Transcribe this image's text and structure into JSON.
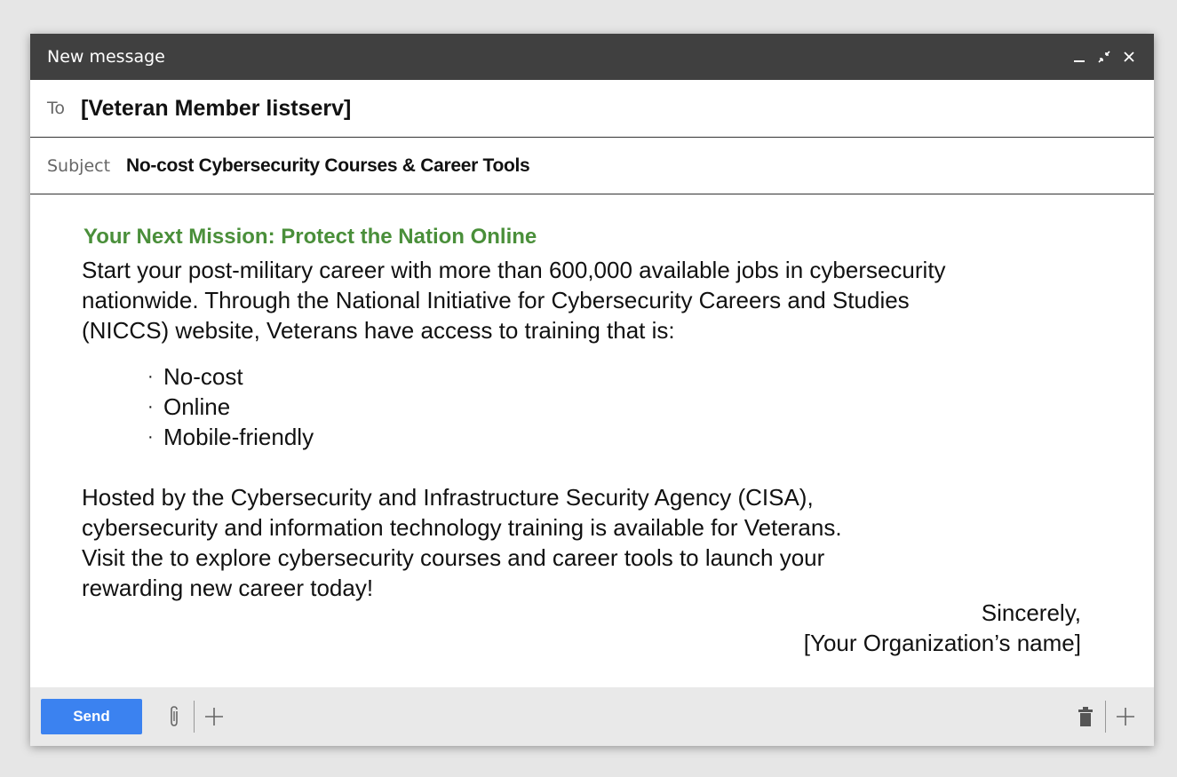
{
  "window": {
    "title": "New message",
    "controls": {
      "minimize": "minimize-icon",
      "expand": "expand-icon",
      "close": "close-icon"
    }
  },
  "to": {
    "label": "To",
    "value": "[Veteran Member listserv]"
  },
  "subject": {
    "label": "Subject",
    "value": "No-cost Cybersecurity Courses & Career Tools"
  },
  "body": {
    "headline": "Your Next Mission: Protect the Nation Online",
    "headline_color": "#4a8f3a",
    "intro_lines": [
      "Start your post-military career with more than 600,000 available jobs in cybersecurity",
      "nationwide. Through the National Initiative for Cybersecurity Careers and Studies",
      "(NICCS) website, Veterans have access to training that is:"
    ],
    "bullets": [
      "No-cost",
      "Online",
      "Mobile-friendly"
    ],
    "closing_lines": [
      "Hosted by the Cybersecurity and Infrastructure Security Agency (CISA),",
      "cybersecurity and information technology training is available for Veterans.",
      "Visit the to explore cybersecurity courses and career tools to launch your",
      "rewarding new career today!"
    ],
    "signoff": "Sincerely,",
    "signature": "[Your Organization’s name]"
  },
  "footer": {
    "send_label": "Send",
    "send_color": "#3b82f0",
    "left_icons": [
      "paperclip-icon",
      "plus-icon"
    ],
    "right_icons": [
      "trash-icon",
      "plus-icon"
    ]
  }
}
